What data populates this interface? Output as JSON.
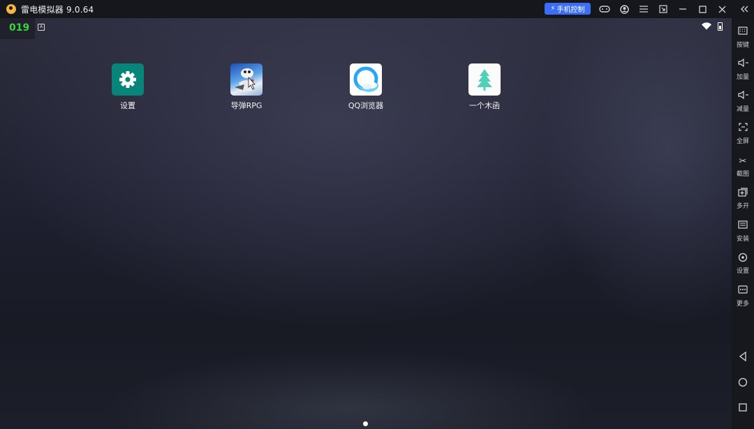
{
  "window": {
    "title": "雷电模拟器 9.0.64",
    "phone_control": "手机控制",
    "buttons": [
      "gamepad-icon",
      "account-icon",
      "menu-icon",
      "minimize-to-window-icon",
      "minimize-icon",
      "maximize-icon",
      "close-icon",
      "collapse-sidebar-icon"
    ]
  },
  "status_bar": {
    "fps": "019"
  },
  "apps": [
    {
      "label": "设置",
      "icon": "settings-gear-icon"
    },
    {
      "label": "导弹RPG",
      "icon": "missile-rpg-game-icon"
    },
    {
      "label": "QQ浏览器",
      "icon": "qq-browser-icon"
    },
    {
      "label": "一个木函",
      "icon": "tree-icon"
    }
  ],
  "sidebar": {
    "items": [
      {
        "label": "按键",
        "icon": "keyboard-icon"
      },
      {
        "label": "加量",
        "icon": "volume-up-icon"
      },
      {
        "label": "减量",
        "icon": "volume-down-icon"
      },
      {
        "label": "全屏",
        "icon": "fullscreen-icon"
      },
      {
        "label": "截图",
        "icon": "scissors-icon"
      },
      {
        "label": "多开",
        "icon": "multi-instance-icon"
      },
      {
        "label": "安装",
        "icon": "install-apk-icon"
      },
      {
        "label": "设置",
        "icon": "settings-icon"
      },
      {
        "label": "更多",
        "icon": "more-icon"
      }
    ],
    "nav": [
      "back-icon",
      "home-icon",
      "recents-icon"
    ]
  },
  "colors": {
    "phone_control_bg": "#3b6ef5",
    "fps_text": "#38d43a",
    "settings_icon_bg": "#08857a",
    "titlebar_bg": "#15171d"
  }
}
